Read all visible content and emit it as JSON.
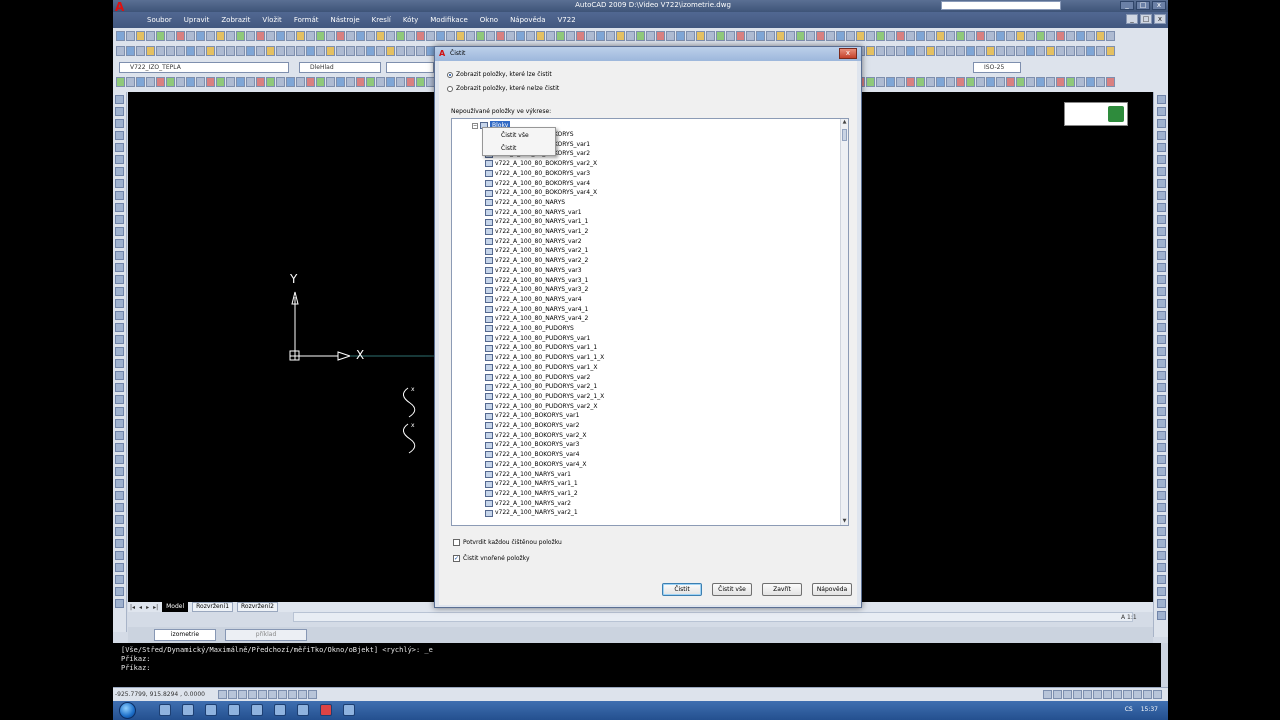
{
  "window": {
    "title": "AutoCAD 2009  D:\\Video V722\\izometrie.dwg",
    "controls": [
      "_",
      "□",
      "x"
    ]
  },
  "menu": [
    "Soubor",
    "Upravit",
    "Zobrazit",
    "Vložit",
    "Formát",
    "Nástroje",
    "Kreslí",
    "Kóty",
    "Modifikace",
    "Okno",
    "Nápověda",
    "V722"
  ],
  "layer_combo": "V722_IZO_TEPLA",
  "color_combo": "DleHlad",
  "dimstyle_combo": "ISO-25",
  "drawing": {
    "axis_y": "Y",
    "axis_x": "X",
    "layout_tabs": [
      "Model",
      "Rozvržení1",
      "Rozvržení2"
    ],
    "scale_readout": "A 1:1"
  },
  "palette_tabs": {
    "active": "izometrie",
    "other": "příklad"
  },
  "command_line": [
    "[Vše/Střed/Dynamický/Maximálně/Předchozí/měřiTko/Okno/oBjekt] <rychlý>: _e",
    "Příkaz:",
    "Příkaz:"
  ],
  "statusbar": {
    "coords": "-925.7799, 915.8294 , 0.0000"
  },
  "taskbar": {
    "lang": "CS",
    "time": "15:37"
  },
  "dialog": {
    "title": "Čistit",
    "radio_can_purge": "Zobrazit položky, které lze čistit",
    "radio_cannot_purge": "Zobrazit položky, které nelze čistit",
    "group_label": "Nepoužívané položky ve výkrese:",
    "root_item": "Bloky",
    "items": [
      "v722_A_100_80_BOKORYS",
      "v722_A_100_80_BOKORYS_var1",
      "v722_A_100_80_BOKORYS_var2",
      "v722_A_100_80_BOKORYS_var2_X",
      "v722_A_100_80_BOKORYS_var3",
      "v722_A_100_80_BOKORYS_var4",
      "v722_A_100_80_BOKORYS_var4_X",
      "v722_A_100_80_NARYS",
      "v722_A_100_80_NARYS_var1",
      "v722_A_100_80_NARYS_var1_1",
      "v722_A_100_80_NARYS_var1_2",
      "v722_A_100_80_NARYS_var2",
      "v722_A_100_80_NARYS_var2_1",
      "v722_A_100_80_NARYS_var2_2",
      "v722_A_100_80_NARYS_var3",
      "v722_A_100_80_NARYS_var3_1",
      "v722_A_100_80_NARYS_var3_2",
      "v722_A_100_80_NARYS_var4",
      "v722_A_100_80_NARYS_var4_1",
      "v722_A_100_80_NARYS_var4_2",
      "v722_A_100_80_PUDORYS",
      "v722_A_100_80_PUDORYS_var1",
      "v722_A_100_80_PUDORYS_var1_1",
      "v722_A_100_80_PUDORYS_var1_1_X",
      "v722_A_100_80_PUDORYS_var1_X",
      "v722_A_100_80_PUDORYS_var2",
      "v722_A_100_80_PUDORYS_var2_1",
      "v722_A_100_80_PUDORYS_var2_1_X",
      "v722_A_100_80_PUDORYS_var2_X",
      "v722_A_100_BOKORYS_var1",
      "v722_A_100_BOKORYS_var2",
      "v722_A_100_BOKORYS_var2_X",
      "v722_A_100_BOKORYS_var3",
      "v722_A_100_BOKORYS_var4",
      "v722_A_100_BOKORYS_var4_X",
      "v722_A_100_NARYS_var1",
      "v722_A_100_NARYS_var1_1",
      "v722_A_100_NARYS_var1_2",
      "v722_A_100_NARYS_var2",
      "v722_A_100_NARYS_var2_1"
    ],
    "context_menu": [
      "Čistit vše",
      "Čistit"
    ],
    "checkbox_confirm": "Potvrdit každou čištěnou položku",
    "checkbox_nested": "Čistit vnořené položky",
    "checkbox_nested_checked": true,
    "buttons": [
      "Čistit",
      "Čistit vše",
      "Zavřít",
      "Nápověda"
    ]
  }
}
